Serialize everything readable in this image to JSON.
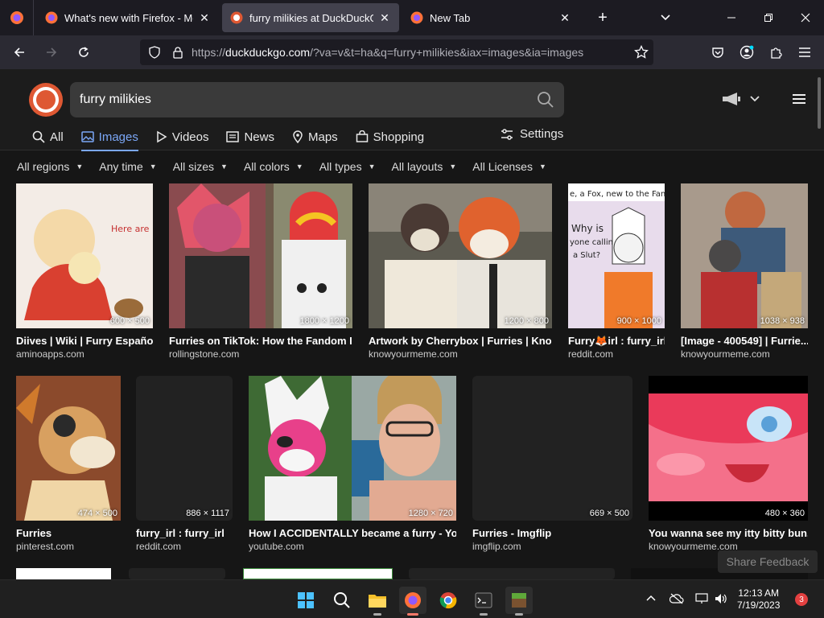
{
  "browser": {
    "tabs": [
      {
        "title": "What's new with Firefox - More",
        "active": false
      },
      {
        "title": "furry milikies at DuckDuckGo",
        "active": true
      },
      {
        "title": "New Tab",
        "active": false
      }
    ],
    "url_prefix": "https://",
    "url_domain": "duckduckgo.com",
    "url_rest": "/?va=v&t=ha&q=furry+milikies&iax=images&ia=images"
  },
  "search": {
    "query": "furry milikies"
  },
  "nav_tabs": [
    {
      "label": "All",
      "icon": "search-icon"
    },
    {
      "label": "Images",
      "icon": "image-icon",
      "active": true
    },
    {
      "label": "Videos",
      "icon": "play-icon"
    },
    {
      "label": "News",
      "icon": "newspaper-icon"
    },
    {
      "label": "Maps",
      "icon": "map-pin-icon"
    },
    {
      "label": "Shopping",
      "icon": "shopping-bag-icon"
    }
  ],
  "settings_label": "Settings",
  "filters": [
    "All regions",
    "Any time",
    "All sizes",
    "All colors",
    "All types",
    "All layouts",
    "All Licenses"
  ],
  "results": [
    {
      "title": "Diives | Wiki | Furry Españo...",
      "source": "aminoapps.com",
      "dims": "600 × 500",
      "color": "#f3ece6"
    },
    {
      "title": "Furries on TikTok: How the Fandom I...",
      "source": "rollingstone.com",
      "dims": "1800 × 1200",
      "color": "#8a4b4f"
    },
    {
      "title": "Artwork by Cherrybox | Furries | Kno...",
      "source": "knowyourmeme.com",
      "dims": "1200 × 800",
      "color": "#5c5a50"
    },
    {
      "title": "Furry🦊irl : furry_irl",
      "source": "reddit.com",
      "dims": "900 × 1000",
      "color": "#e8dcec"
    },
    {
      "title": "[Image - 400549] | Furrie...",
      "source": "knowyourmeme.com",
      "dims": "1038 × 938",
      "color": "#6a5e54"
    },
    {
      "title": "Furries",
      "source": "pinterest.com",
      "dims": "474 × 500",
      "color": "#8b4a2c"
    },
    {
      "title": "furry_irl : furry_irl",
      "source": "reddit.com",
      "dims": "886 × 1117",
      "color": "#222222"
    },
    {
      "title": "How I ACCIDENTALLY became a furry - Yo...",
      "source": "youtube.com",
      "dims": "1280 × 720",
      "color": "#7a5a60"
    },
    {
      "title": "Furries - Imgflip",
      "source": "imgflip.com",
      "dims": "669 × 500",
      "color": "#222222"
    },
    {
      "title": "You wanna see my itty bitty bun...",
      "source": "knowyourmeme.com",
      "dims": "480 × 360",
      "color": "#f0607a"
    }
  ],
  "feedback_label": "Share Feedback",
  "taskbar": {
    "time": "12:13 AM",
    "date": "7/19/2023",
    "notifications": "3"
  }
}
